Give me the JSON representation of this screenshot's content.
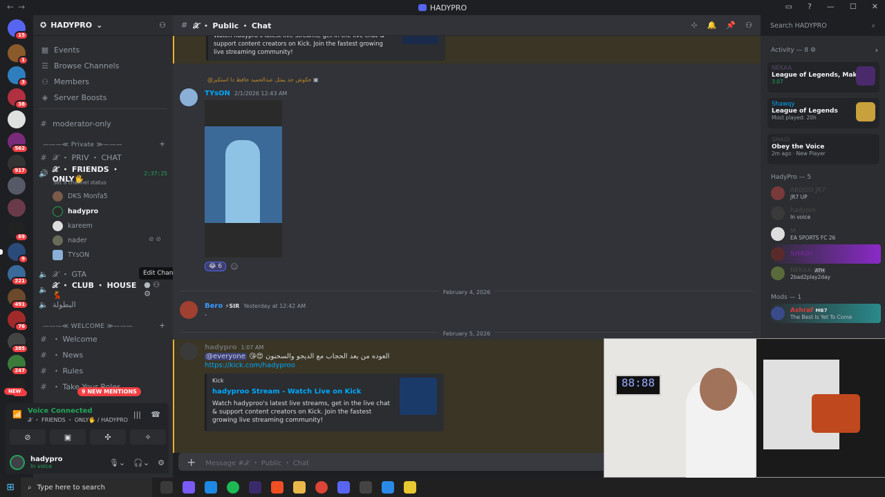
{
  "window": {
    "title": "HADYPRO"
  },
  "server_badges": [
    "15",
    "1",
    "3",
    "38",
    "562",
    "917",
    "69",
    "221",
    "9",
    "491",
    "76",
    "385",
    "247",
    "777",
    "NEW"
  ],
  "guild": {
    "name": "HADYPRO",
    "menu": [
      "Events",
      "Browse Channels",
      "Members",
      "Server Boosts"
    ],
    "channels": {
      "moderator": "moderator-only",
      "private_cat": "———≪ Private ≫———",
      "priv_chat": "𝒳 ・ PRIV ・ CHAT",
      "friends_only": "𝒳 ・ FRIENDS ・ ONLY🖐",
      "friends_timer": "2:37:25",
      "set_status": "Set a channel status",
      "voice_users": [
        "DKS Monfa5",
        "hadypro",
        "kareem",
        "nader",
        "TYsON"
      ],
      "gta": "𝒳 ・ GTA",
      "club_house": "𝒳 ・ CLUB ・ HOUSE💃",
      "albatolah": "البطولة",
      "welcome_cat": "———≪ WELCOME ≫———",
      "welcome": "・ Welcome",
      "news": "・ News",
      "rules": "・ Rules",
      "take_roles": "・ Take Your Roles"
    },
    "tooltip": "Edit Channel",
    "new_mentions": "9 NEW MENTIONS"
  },
  "voice_panel": {
    "status": "Voice Connected",
    "sub": "𝒳 ・ FRIENDS ・ ONLY🖐 / HADYPRO"
  },
  "user_panel": {
    "name": "hadypro",
    "status": "In voice"
  },
  "chat": {
    "channel": "𝒳 ・ Public ・ Chat",
    "search_placeholder": "Search HADYPRO",
    "embed_top": "Watch hadypro's latest live streams, get in the live chat & support content creators on Kick. Join the fastest growing live streaming community!",
    "reply_line": "@حكوش حد يمثل عبدالحميد حافظ دا استكير",
    "msg1": {
      "author": "TYsON",
      "time": "2/1/2026 12:43 AM",
      "reaction_count": "6"
    },
    "date1": "February 4, 2026",
    "msg2": {
      "author": "Bero",
      "tag": "⚡SIR",
      "time": "Yesterday at 12:42 AM",
      "text": "."
    },
    "date2": "February 5, 2026",
    "msg3": {
      "author": "hadypro",
      "time": "1:07 AM",
      "mention": "@everyone",
      "text": "العوده من بعد الحجاب مع الديجو والسحنون",
      "link": "https://kick.com/hadyproo"
    },
    "embed": {
      "provider": "Kick",
      "title": "hadyproo Stream - Watch Live on Kick",
      "desc": "Watch hadyproo's latest live streams, get in the live chat & support content creators on Kick. Join the fastest growing live streaming community!"
    },
    "input_placeholder": "Message #𝒳 ・ Public ・ Chat"
  },
  "members": {
    "activity_header": "Activity — 8",
    "activities": [
      {
        "user": "NEKAA",
        "game": "League of Legends, Mako",
        "sub": "3:07"
      },
      {
        "user": "Shawqy",
        "game": "League of Legends",
        "sub": "Most played: 20h"
      },
      {
        "user": "SHAGI",
        "game": "Obey the Voice",
        "sub": "2m ago · New Player"
      }
    ],
    "group_header": "HadyPro — 5",
    "group": [
      {
        "name": "ABDOO JR7",
        "sub": "JR7 UP"
      },
      {
        "name": "hadypro",
        "sub": "In voice"
      },
      {
        "name": "M",
        "sub": "EA SPORTS FC 26"
      },
      {
        "name": "SHADI",
        "sub": ""
      },
      {
        "name": "NEKAA",
        "tag": "ATH",
        "sub": "2bad2play2day"
      }
    ],
    "mods_header": "Mods — 1",
    "mods": [
      {
        "name": "Ashraf",
        "tag": "MB7",
        "sub": "The Best Is Yet To Come"
      }
    ]
  },
  "taskbar": {
    "search": "Type here to search"
  }
}
